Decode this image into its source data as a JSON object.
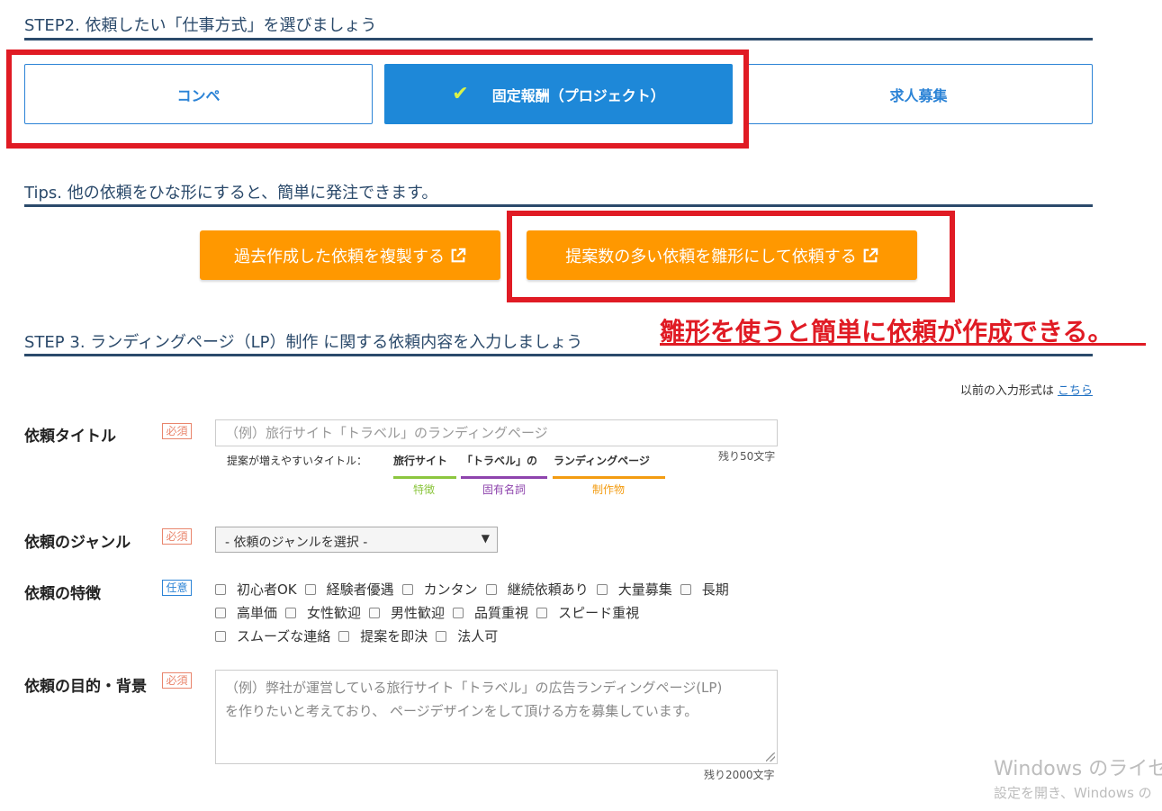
{
  "step2": {
    "title": "STEP2. 依頼したい「仕事方式」を選びましょう",
    "options": [
      {
        "label": "コンペ",
        "selected": false
      },
      {
        "label": "固定報酬（プロジェクト）",
        "selected": true
      },
      {
        "label": "求人募集",
        "selected": false
      }
    ],
    "check_icon": "✔"
  },
  "tips": {
    "title": "Tips. 他の依頼をひな形にすると、簡単に発注できます。",
    "btn_copy": "過去作成した依頼を複製する",
    "btn_template": "提案数の多い依頼を雛形にして依頼する"
  },
  "annotation": "雛形を使うと簡単に依頼が作成できる。",
  "step3": {
    "title": "STEP 3. ランディングページ（LP）制作 に関する依頼内容を入力しましょう"
  },
  "prev_format": {
    "text": "以前の入力形式は",
    "link": "こちら"
  },
  "form": {
    "title_label": "依頼タイトル",
    "required": "必須",
    "optional": "任意",
    "title_placeholder": "（例）旅行サイト「トラベル」のランディングページ",
    "title_counter": "残り50文字",
    "hint_lead": "提案が増えやすいタイトル：",
    "hint_parts": [
      {
        "text": "旅行サイト",
        "tag": "特徴",
        "color": "#8cc63f"
      },
      {
        "text": "「トラベル」の",
        "tag": "固有名詞",
        "color": "#8e44ad"
      },
      {
        "text": "ランディングページ",
        "tag": "制作物",
        "color": "#f39c12"
      }
    ],
    "genre_label": "依頼のジャンル",
    "genre_select": "- 依頼のジャンルを選択 -",
    "features_label": "依頼の特徴",
    "features_row1": [
      "初心者OK",
      "経験者優遇",
      "カンタン",
      "継続依頼あり",
      "大量募集",
      "長期"
    ],
    "features_row2": [
      "高単価",
      "女性歓迎",
      "男性歓迎",
      "品質重視",
      "スピード重視"
    ],
    "features_row3": [
      "スムーズな連絡",
      "提案を即決",
      "法人可"
    ],
    "purpose_label": "依頼の目的・背景",
    "purpose_placeholder_1": "（例）弊社が運営している旅行サイト「トラベル」の広告ランディングページ(LP)",
    "purpose_placeholder_2": "を作りたいと考えており、 ページデザインをして頂ける方を募集しています。",
    "purpose_counter": "残り2000文字"
  },
  "watermark": {
    "line1": "Windows のライセ",
    "line2": "設定を開き、Windows の"
  }
}
